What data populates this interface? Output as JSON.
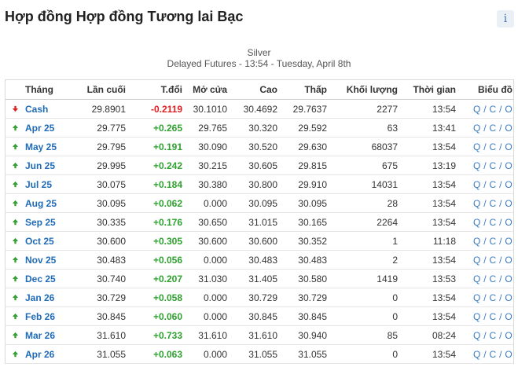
{
  "page": {
    "title": "Hợp đồng Hợp đồng Tương lai Bạc",
    "info_icon": "i",
    "subtitle_1": "Silver",
    "subtitle_2": "Delayed Futures - 13:54 - Tuesday, April 8th"
  },
  "colors": {
    "up": "#2ea12e",
    "down": "#e02020",
    "link": "#3a7cc6",
    "month": "#1f6bb8"
  },
  "table": {
    "headers": {
      "month": "Tháng",
      "last": "Lần cuối",
      "change": "T.đổi",
      "open": "Mở cửa",
      "high": "Cao",
      "low": "Thấp",
      "volume": "Khối lượng",
      "time": "Thời gian",
      "chart": "Biểu đồ"
    },
    "rows": [
      {
        "direction": "down",
        "month": "Cash",
        "last": "29.8901",
        "change": "-0.2119",
        "open": "30.1010",
        "high": "30.4692",
        "low": "29.7637",
        "volume": "2277",
        "time": "13:54",
        "chart": "Q / C / O"
      },
      {
        "direction": "up",
        "month": "Apr 25",
        "last": "29.775",
        "change": "+0.265",
        "open": "29.765",
        "high": "30.320",
        "low": "29.592",
        "volume": "63",
        "time": "13:41",
        "chart": "Q / C / O"
      },
      {
        "direction": "up",
        "month": "May 25",
        "last": "29.795",
        "change": "+0.191",
        "open": "30.090",
        "high": "30.520",
        "low": "29.630",
        "volume": "68037",
        "time": "13:54",
        "chart": "Q / C / O"
      },
      {
        "direction": "up",
        "month": "Jun 25",
        "last": "29.995",
        "change": "+0.242",
        "open": "30.215",
        "high": "30.605",
        "low": "29.815",
        "volume": "675",
        "time": "13:19",
        "chart": "Q / C / O"
      },
      {
        "direction": "up",
        "month": "Jul 25",
        "last": "30.075",
        "change": "+0.184",
        "open": "30.380",
        "high": "30.800",
        "low": "29.910",
        "volume": "14031",
        "time": "13:54",
        "chart": "Q / C / O"
      },
      {
        "direction": "up",
        "month": "Aug 25",
        "last": "30.095",
        "change": "+0.062",
        "open": "0.000",
        "high": "30.095",
        "low": "30.095",
        "volume": "28",
        "time": "13:54",
        "chart": "Q / C / O"
      },
      {
        "direction": "up",
        "month": "Sep 25",
        "last": "30.335",
        "change": "+0.176",
        "open": "30.650",
        "high": "31.015",
        "low": "30.165",
        "volume": "2264",
        "time": "13:54",
        "chart": "Q / C / O"
      },
      {
        "direction": "up",
        "month": "Oct 25",
        "last": "30.600",
        "change": "+0.305",
        "open": "30.600",
        "high": "30.600",
        "low": "30.352",
        "volume": "1",
        "time": "11:18",
        "chart": "Q / C / O"
      },
      {
        "direction": "up",
        "month": "Nov 25",
        "last": "30.483",
        "change": "+0.056",
        "open": "0.000",
        "high": "30.483",
        "low": "30.483",
        "volume": "2",
        "time": "13:54",
        "chart": "Q / C / O"
      },
      {
        "direction": "up",
        "month": "Dec 25",
        "last": "30.740",
        "change": "+0.207",
        "open": "31.030",
        "high": "31.405",
        "low": "30.580",
        "volume": "1419",
        "time": "13:53",
        "chart": "Q / C / O"
      },
      {
        "direction": "up",
        "month": "Jan 26",
        "last": "30.729",
        "change": "+0.058",
        "open": "0.000",
        "high": "30.729",
        "low": "30.729",
        "volume": "0",
        "time": "13:54",
        "chart": "Q / C / O"
      },
      {
        "direction": "up",
        "month": "Feb 26",
        "last": "30.845",
        "change": "+0.060",
        "open": "0.000",
        "high": "30.845",
        "low": "30.845",
        "volume": "0",
        "time": "13:54",
        "chart": "Q / C / O"
      },
      {
        "direction": "up",
        "month": "Mar 26",
        "last": "31.610",
        "change": "+0.733",
        "open": "31.610",
        "high": "31.610",
        "low": "30.940",
        "volume": "85",
        "time": "08:24",
        "chart": "Q / C / O"
      },
      {
        "direction": "up",
        "month": "Apr 26",
        "last": "31.055",
        "change": "+0.063",
        "open": "0.000",
        "high": "31.055",
        "low": "31.055",
        "volume": "0",
        "time": "13:54",
        "chart": "Q / C / O"
      }
    ]
  }
}
